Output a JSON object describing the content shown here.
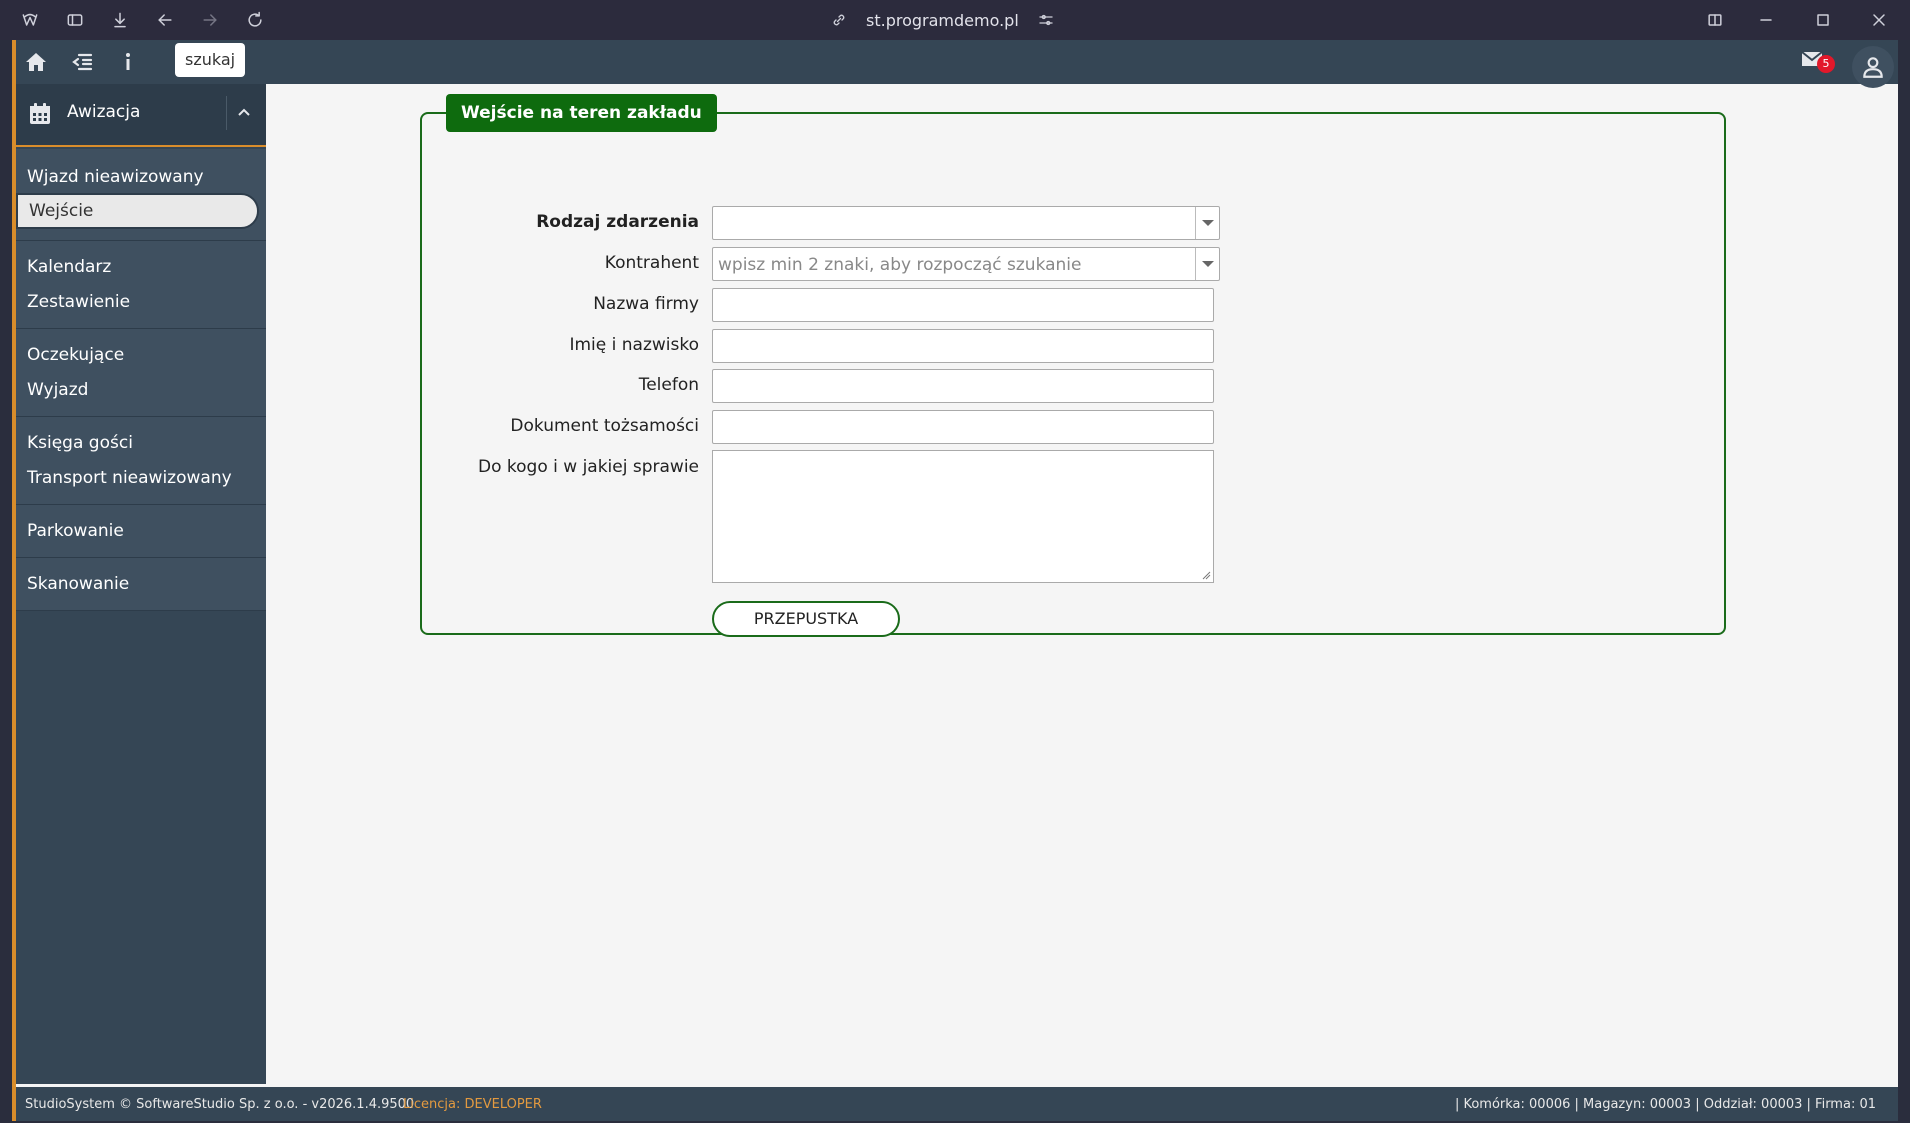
{
  "browser": {
    "url": "st.programdemo.pl"
  },
  "topbar": {
    "search_label": "szukaj",
    "mail_count": "5"
  },
  "sidebar": {
    "header": "Awizacja",
    "groups": [
      [
        "Wjazd nieawizowany",
        "Wejście"
      ],
      [
        "Kalendarz",
        "Zestawienie"
      ],
      [
        "Oczekujące",
        "Wyjazd"
      ],
      [
        "Księga gości",
        "Transport nieawizowany"
      ],
      [
        "Parkowanie"
      ],
      [
        "Skanowanie"
      ]
    ],
    "active_item": "Wejście"
  },
  "form": {
    "title": "Wejście na teren zakładu",
    "fields": {
      "rodzaj": {
        "label": "Rodzaj zdarzenia",
        "value": ""
      },
      "kontrahent": {
        "label": "Kontrahent",
        "placeholder": "wpisz min 2 znaki, aby rozpocząć szukanie"
      },
      "firma": {
        "label": "Nazwa firmy",
        "value": ""
      },
      "imie": {
        "label": "Imię i nazwisko",
        "value": ""
      },
      "telefon": {
        "label": "Telefon",
        "value": ""
      },
      "dokument": {
        "label": "Dokument tożsamości",
        "value": ""
      },
      "sprawa": {
        "label": "Do kogo i w jakiej sprawie",
        "value": ""
      }
    },
    "submit_label": "PRZEPUSTKA"
  },
  "footer": {
    "copyright": "StudioSystem © SoftwareStudio Sp. z o.o. - v2026.1.4.9500",
    "license_prefix": "Licencja: ",
    "license_value": "DEVELOPER",
    "info": "| Komórka: 00006 | Magazyn: 00003 | Oddział: 00003 | Firma: 01"
  },
  "colors": {
    "accent_green": "#0e6b0e",
    "sidebar_bg": "#354655",
    "accent_orange": "#d98d2b",
    "badge_red": "#e2182a"
  }
}
